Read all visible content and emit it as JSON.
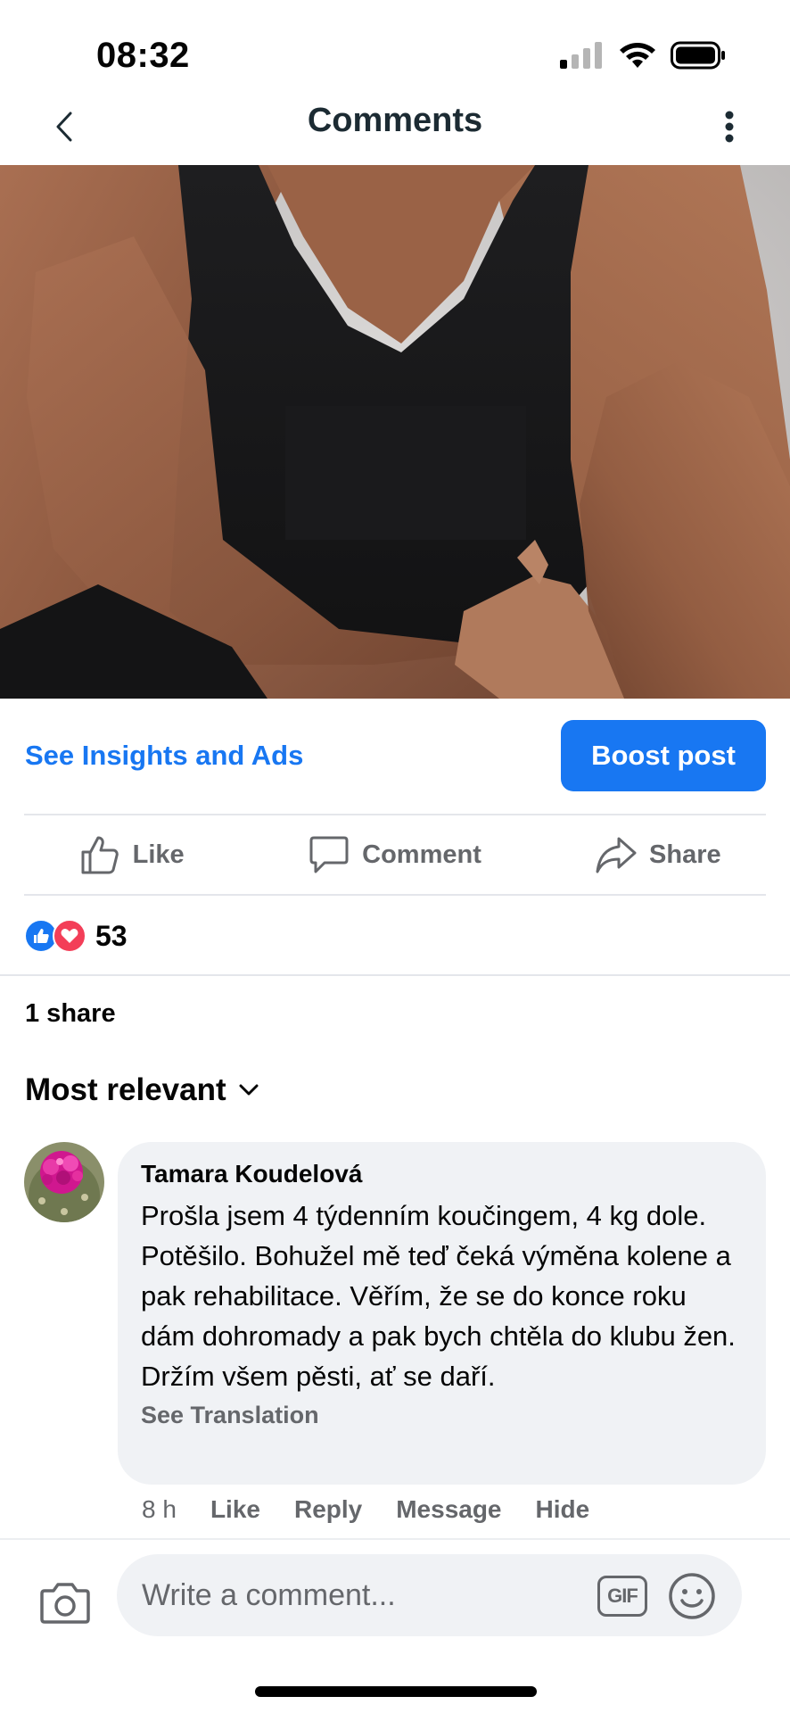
{
  "status_bar": {
    "time": "08:32"
  },
  "nav": {
    "title": "Comments"
  },
  "post": {
    "insights_link": "See Insights and Ads",
    "boost_button": "Boost post",
    "actions": {
      "like": "Like",
      "comment": "Comment",
      "share": "Share"
    },
    "reaction_count": "53",
    "shares": "1 share"
  },
  "sort": {
    "label": "Most relevant"
  },
  "comments": [
    {
      "author": "Tamara Koudelová",
      "text": "Prošla jsem 4 týdenním koučingem, 4 kg dole. Potěšilo. Bohužel mě teď čeká výměna kolene a pak rehabilitace. Věřím, že se do konce roku dám dohromady a pak bych chtěla do klubu žen. Držím všem pěsti, ať se daří.",
      "see_translation": "See Translation",
      "time": "8 h",
      "actions": {
        "like": "Like",
        "reply": "Reply",
        "message": "Message",
        "hide": "Hide"
      }
    }
  ],
  "composer": {
    "placeholder": "Write a comment...",
    "gif_label": "GIF"
  },
  "colors": {
    "accent": "#1877f2",
    "love": "#f33e58",
    "secondary_text": "#65676b",
    "bubble": "#f0f2f5"
  }
}
